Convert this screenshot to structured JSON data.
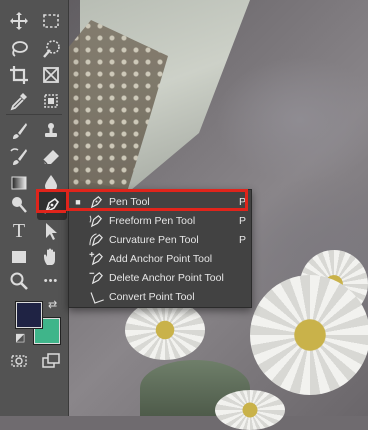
{
  "menu": {
    "items": [
      {
        "label": "Pen Tool",
        "shortcut": "P",
        "checked": true,
        "icon": "pen-icon"
      },
      {
        "label": "Freeform Pen Tool",
        "shortcut": "P",
        "checked": false,
        "icon": "freeform-pen-icon"
      },
      {
        "label": "Curvature Pen Tool",
        "shortcut": "P",
        "checked": false,
        "icon": "curvature-pen-icon"
      },
      {
        "label": "Add Anchor Point Tool",
        "shortcut": "",
        "checked": false,
        "icon": "add-anchor-point-icon"
      },
      {
        "label": "Delete Anchor Point Tool",
        "shortcut": "",
        "checked": false,
        "icon": "delete-anchor-point-icon"
      },
      {
        "label": "Convert Point Tool",
        "shortcut": "",
        "checked": false,
        "icon": "convert-point-icon"
      }
    ]
  },
  "toolbar": {
    "text_tool_glyph": "T",
    "more_tools_glyph": "•••"
  },
  "colors": {
    "foreground": "#1f2344",
    "background": "#3fb58a",
    "highlight": "#e0241b",
    "toolbar_bg": "#535353",
    "menu_bg": "#424242"
  }
}
